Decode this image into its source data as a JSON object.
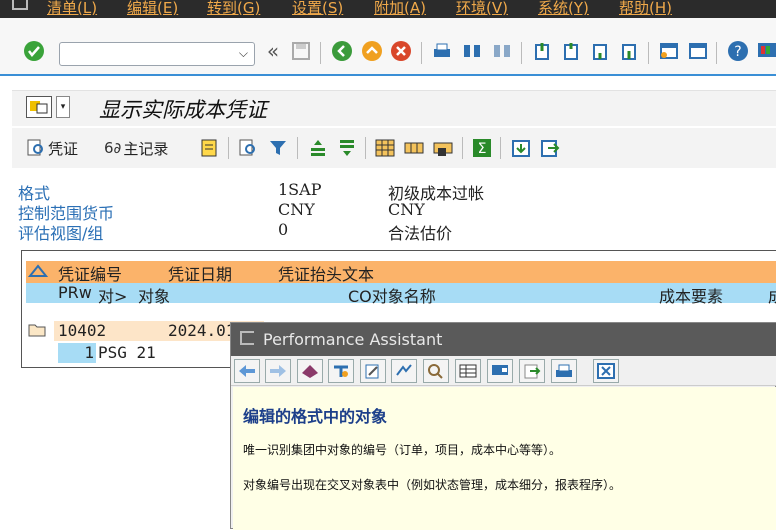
{
  "menu": {
    "items": [
      "清单(L)",
      "编辑(E)",
      "转到(G)",
      "设置(S)",
      "附加(A)",
      "环境(V)",
      "系统(Y)",
      "帮助(H)"
    ]
  },
  "toolbar": {
    "command_value": "",
    "back_glyph": "«",
    "icons": [
      "enter-icon",
      "save-icon",
      "back-icon",
      "exit-icon",
      "cancel-icon",
      "print-icon",
      "find-icon",
      "find-next-icon",
      "first-page-icon",
      "previous-page-icon",
      "next-page-icon",
      "last-page-icon",
      "new-session-icon",
      "shortcut-icon",
      "help-icon",
      "layout-icon"
    ]
  },
  "title": {
    "text": "显示实际成本凭证"
  },
  "app_toolbar": {
    "doc_button": "凭证",
    "master_button": "主记录"
  },
  "header_info": {
    "rows": [
      {
        "label": "格式",
        "value": "1SAP",
        "desc": "初级成本过帐"
      },
      {
        "label": "控制范围货币",
        "value": "CNY",
        "desc": "CNY"
      },
      {
        "label": "评估视图/组",
        "value": "0",
        "desc": "合法估价"
      }
    ]
  },
  "report": {
    "header1": {
      "doc_no": "凭证编号",
      "doc_date": "凭证日期",
      "header_text": "凭证抬头文本"
    },
    "header2": {
      "prw": "PRw",
      "obj_type": "对>",
      "object": "对象",
      "co_name": "CO对象名称",
      "cost_element": "成本要素",
      "trail": "成"
    },
    "row1": {
      "doc_no": "10402",
      "doc_date": "2024.01"
    },
    "row2": {
      "prw": "1",
      "object": "PSG 21"
    }
  },
  "performance_assistant": {
    "title": "Performance Assistant",
    "heading": "编辑的格式中的对象",
    "para1": "唯一识别集团中对象的编号（订单，项目，成本中心等等）。",
    "para2": "对象编号出现在交叉对象表中（例如状态管理，成本细分，报表程序）。"
  },
  "colors": {
    "menubar_bg": "#2b2b2b",
    "menu_text": "#f0a94a",
    "accent_blue": "#3a8fd6",
    "header_orange": "#fbb36a",
    "header_blue": "#a7dcf5",
    "pa_content_bg": "#ffffe6"
  }
}
